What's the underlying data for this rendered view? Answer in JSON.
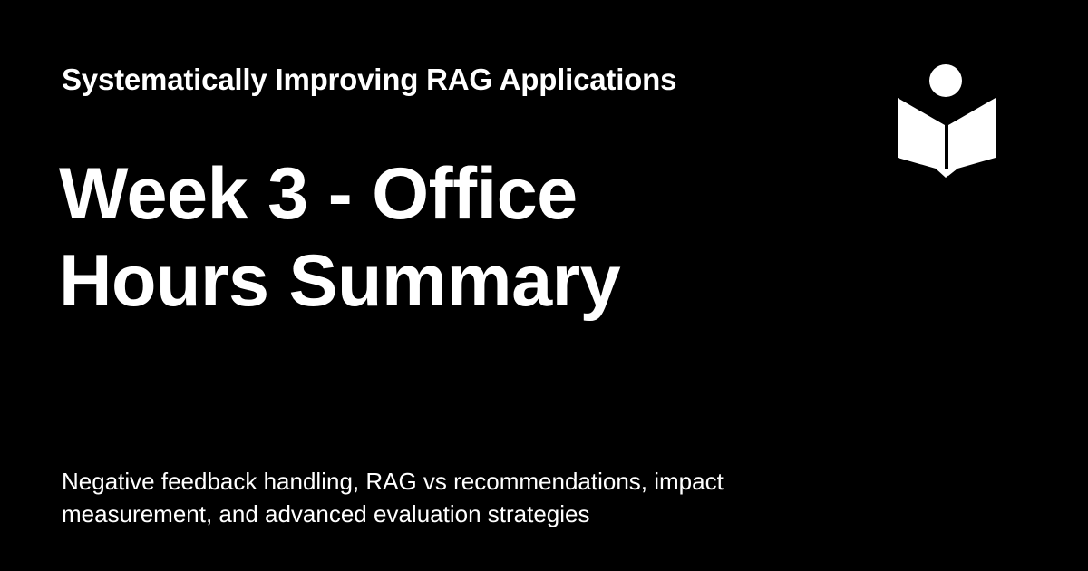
{
  "site": {
    "name": "Systematically Improving RAG Applications"
  },
  "page": {
    "title": "Week 3 - Office Hours Summary",
    "description": "Negative feedback handling, RAG vs recommendations, impact measurement, and advanced evaluation strategies"
  },
  "logo": {
    "icon": "reader-book-icon"
  },
  "colors": {
    "background": "#000000",
    "foreground": "#ffffff"
  }
}
